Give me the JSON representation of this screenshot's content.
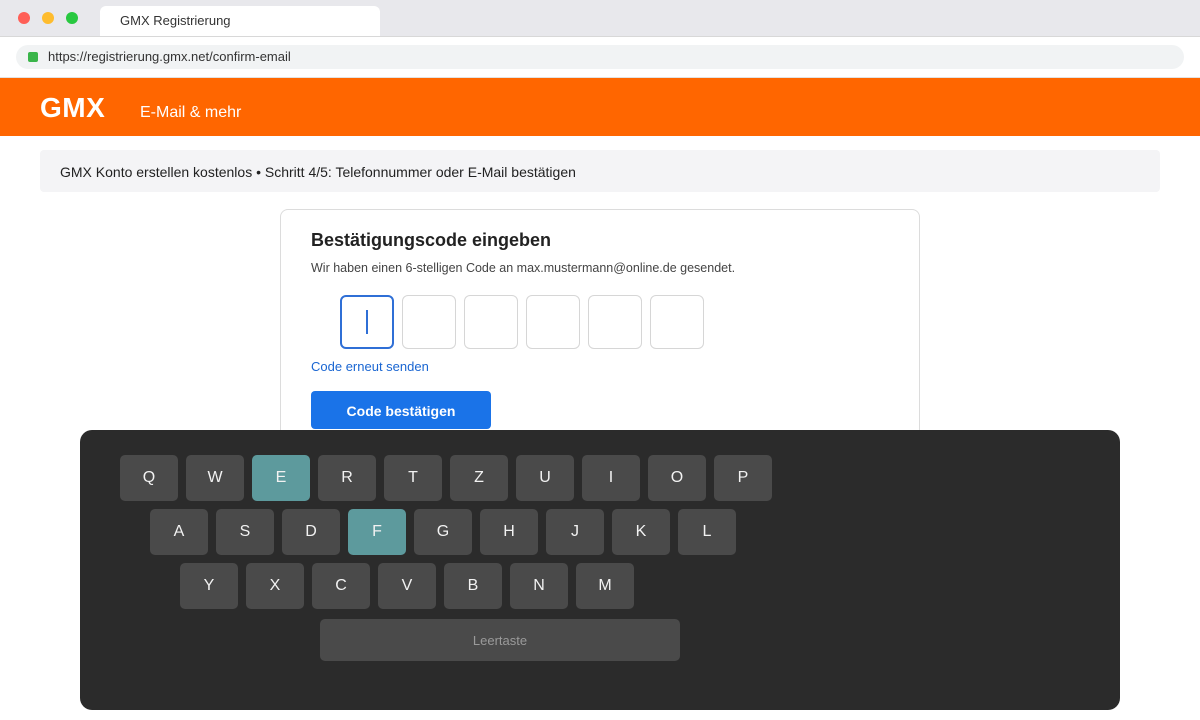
{
  "browser": {
    "tab_title": "GMX Registrierung",
    "url": "https://registrierung.gmx.net/confirm-email"
  },
  "header": {
    "logo": "GMX",
    "tagline": "E-Mail & mehr"
  },
  "step": {
    "text": "GMX Konto erstellen kostenlos • Schritt 4/5: Telefonnummer oder E-Mail bestätigen"
  },
  "card": {
    "title": "Bestätigungscode eingeben",
    "description": "Wir haben einen 6-stelligen Code an max.mustermann@online.de gesendet.",
    "code_values": [
      "",
      "",
      "",
      "",
      "",
      ""
    ],
    "active_box": 1,
    "resend_label": "Code erneut senden",
    "confirm_label": "Code bestätigen"
  },
  "keyboard": {
    "rows": [
      [
        "Q",
        "W",
        "E",
        "R",
        "T",
        "Z",
        "U",
        "I",
        "O",
        "P"
      ],
      [
        "A",
        "S",
        "D",
        "F",
        "G",
        "H",
        "J",
        "K",
        "L"
      ],
      [
        "Y",
        "X",
        "C",
        "V",
        "B",
        "N",
        "M"
      ]
    ],
    "highlighted_keys": [
      "E",
      "F"
    ],
    "space_label": "Leertaste"
  },
  "colors": {
    "brand_orange": "#ff6600",
    "primary_blue": "#1a73e8",
    "key_highlight": "#5d9a9d"
  }
}
